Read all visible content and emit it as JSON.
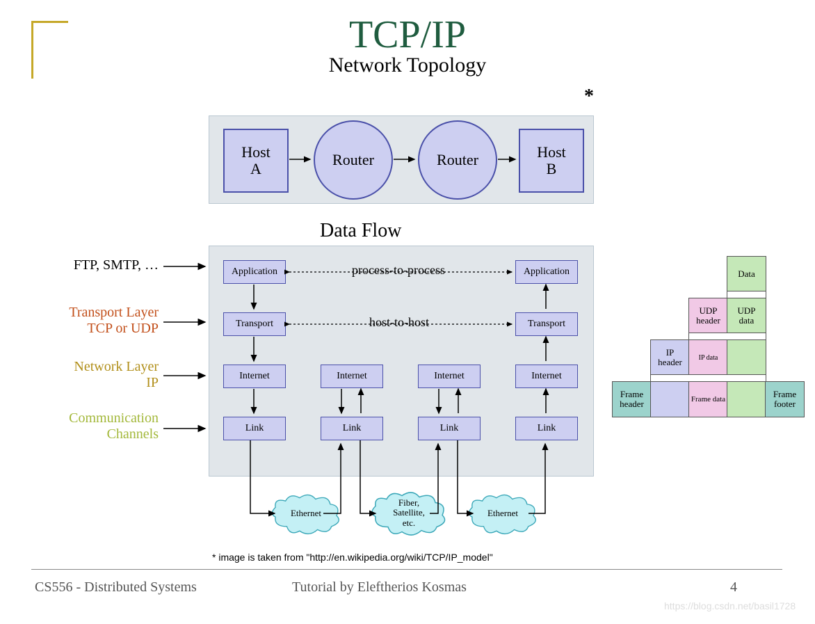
{
  "title": "TCP/IP",
  "topology": {
    "heading": "Network Topology",
    "host_a_l1": "Host",
    "host_a_l2": "A",
    "router1": "Router",
    "router2": "Router",
    "host_b_l1": "Host",
    "host_b_l2": "B"
  },
  "asterisk": "*",
  "dataflow": {
    "heading": "Data Flow",
    "p2p": "process-to-process",
    "h2h": "host-to-host",
    "layers": {
      "app": "Application",
      "trans": "Transport",
      "inet": "Internet",
      "link": "Link"
    },
    "clouds": {
      "eth1": "Ethernet",
      "fiber": "Fiber,\nSatellite,\netc.",
      "eth2": "Ethernet"
    }
  },
  "left_labels": {
    "l1": "FTP, SMTP, …",
    "l2a": "Transport Layer",
    "l2b": "TCP or UDP",
    "l3a": "Network Layer",
    "l3b": "IP",
    "l4a": "Communication",
    "l4b": "Channels"
  },
  "encapsulation": {
    "data": "Data",
    "udp_h": "UDP\nheader",
    "udp_d": "UDP\ndata",
    "ip_h": "IP\nheader",
    "ip_d": "IP data",
    "frame_h": "Frame\nheader",
    "frame_d": "Frame data",
    "frame_f": "Frame\nfooter"
  },
  "citation": "* image is taken from \"http://en.wikipedia.org/wiki/TCP/IP_model\"",
  "footer": {
    "left": "CS556 - Distributed Systems",
    "mid": "Tutorial by Eleftherios Kosmas",
    "page": "4"
  },
  "watermark": "https://blog.csdn.net/basil1728"
}
